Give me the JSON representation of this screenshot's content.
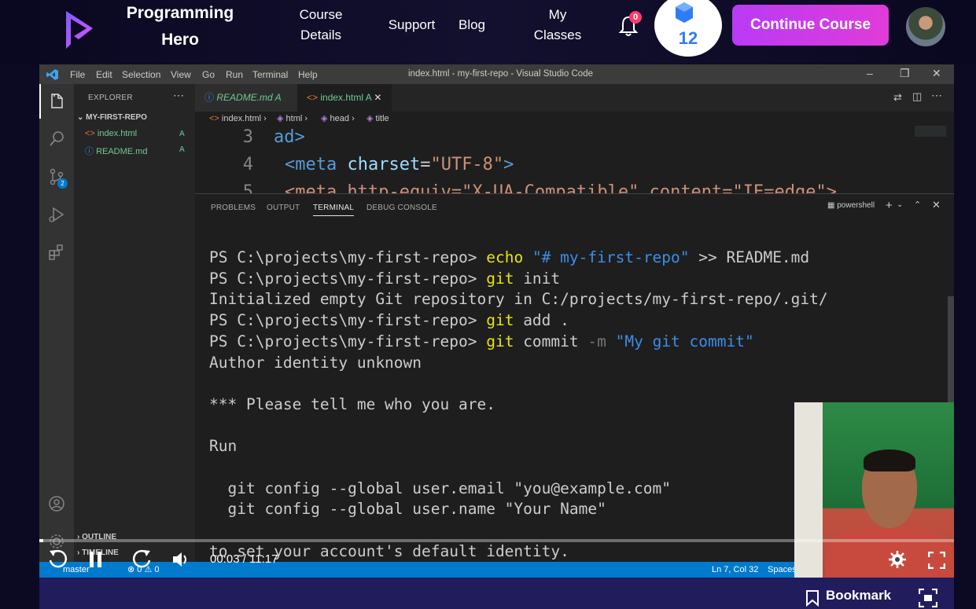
{
  "header": {
    "brand": [
      "Programming",
      "Hero"
    ],
    "nav": {
      "course_details": [
        "Course",
        "Details"
      ],
      "support": "Support",
      "blog": "Blog",
      "my_classes": [
        "My",
        "Classes"
      ]
    },
    "notification_count": "0",
    "gems": "12",
    "continue_label": "Continue Course"
  },
  "vscode": {
    "menu": [
      "File",
      "Edit",
      "Selection",
      "View",
      "Go",
      "Run",
      "Terminal",
      "Help"
    ],
    "window_title": "index.html - my-first-repo - Visual Studio Code",
    "explorer": {
      "title": "EXPLORER",
      "folder": "MY-FIRST-REPO",
      "files": [
        {
          "name": "index.html",
          "status": "A"
        },
        {
          "name": "README.md",
          "status": "A"
        }
      ],
      "outline": "OUTLINE",
      "timeline": "TIMELINE"
    },
    "source_control_badge": "2",
    "tabs": [
      {
        "name": "README.md",
        "status": "A"
      },
      {
        "name": "index.html",
        "status": "A"
      }
    ],
    "breadcrumb": [
      "index.html",
      "html",
      "head",
      "title"
    ],
    "editor_lines": [
      {
        "num": "3",
        "text": "ad>"
      },
      {
        "num": "4",
        "tag": "<meta",
        "attr": "charset",
        "val": "\"UTF-8\"",
        "close": ">"
      },
      {
        "num": "5",
        "text": "<meta http-equiv=\"X-UA-Compatible\" content=\"IE=edge\">"
      }
    ],
    "panel_tabs": [
      "PROBLEMS",
      "OUTPUT",
      "TERMINAL",
      "DEBUG CONSOLE"
    ],
    "shell": "powershell",
    "terminal": {
      "prompt": "PS C:\\projects\\my-first-repo>",
      "l1_cmd": "echo",
      "l1_str": "\"# my-first-repo\"",
      "l1_rest": " >> README.md",
      "l2_cmd": "git",
      "l2_rest": " init",
      "l3": "Initialized empty Git repository in C:/projects/my-first-repo/.git/",
      "l4_cmd": "git",
      "l4_rest": " add .",
      "l5_cmd": "git",
      "l5_rest": " commit ",
      "l5_flag": "-m",
      "l5_str": "\"My git commit\"",
      "l6": "Author identity unknown",
      "l7": "*** Please tell me who you are.",
      "l8": "Run",
      "l9": "  git config --global user.email \"you@example.com\"",
      "l10": "  git config --global user.name \"Your Name\"",
      "l11": "to set your account's default identity."
    },
    "status": {
      "branch": "master",
      "errors": "0",
      "warnings": "0",
      "position": "Ln 7, Col 32",
      "spaces": "Spaces"
    }
  },
  "player": {
    "time": "00:03 / 11:17",
    "progress": 0.004,
    "bookmark": "Bookmark"
  }
}
